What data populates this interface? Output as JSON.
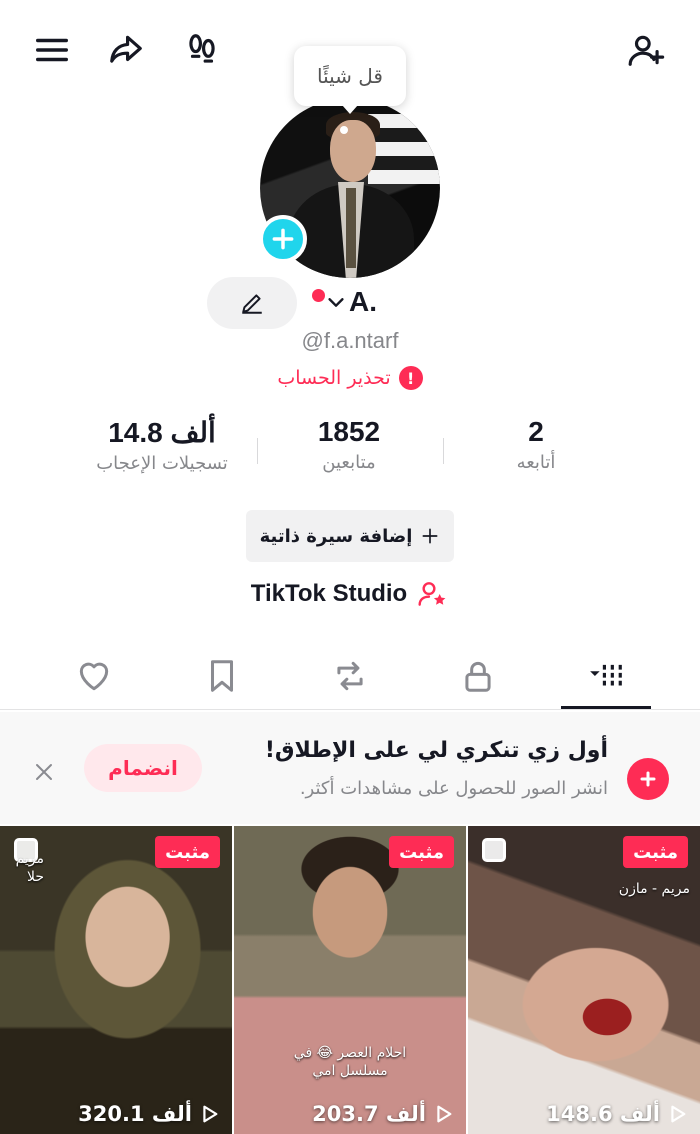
{
  "profile": {
    "tooltip": "قل شيئًا",
    "display_name": "A.",
    "username": "@f.a.ntarf",
    "warning": "تحذير الحساب",
    "warning_mark": "!"
  },
  "stats": {
    "following_count": "2",
    "following_label": "أتابعه",
    "followers_count": "1852",
    "followers_label": "متابعين",
    "likes_count": "14.8 ألف",
    "likes_label": "تسجيلات الإعجاب"
  },
  "actions": {
    "add_bio": "إضافة سيرة ذاتية",
    "studio": "TikTok Studio"
  },
  "tabs": [
    "videos",
    "private",
    "reposts",
    "favorites",
    "liked"
  ],
  "promo": {
    "title": "أول زي تنكري لي على الإطلاق!",
    "subtitle": "انشر الصور للحصول على مشاهدات أكثر.",
    "join": "انضمام"
  },
  "videos": [
    {
      "badge": "مثبت",
      "views": "148.6 ألف",
      "overlay": "مريم - مازن"
    },
    {
      "badge": "مثبت",
      "views": "203.7 ألف",
      "overlay": "احلام العصر 😂 في مسلسل امي"
    },
    {
      "badge": "مثبت",
      "views": "320.1 ألف",
      "overlay": "مريم حلا"
    }
  ],
  "colors": {
    "accent": "#fe2c55",
    "avatar_add": "#20d5ec",
    "text": "#161823",
    "muted": "#86878b"
  },
  "icons": {
    "menu": "hamburger-icon",
    "share": "share-icon",
    "footprints": "footprints-icon",
    "add_friend": "add-friend-icon"
  }
}
